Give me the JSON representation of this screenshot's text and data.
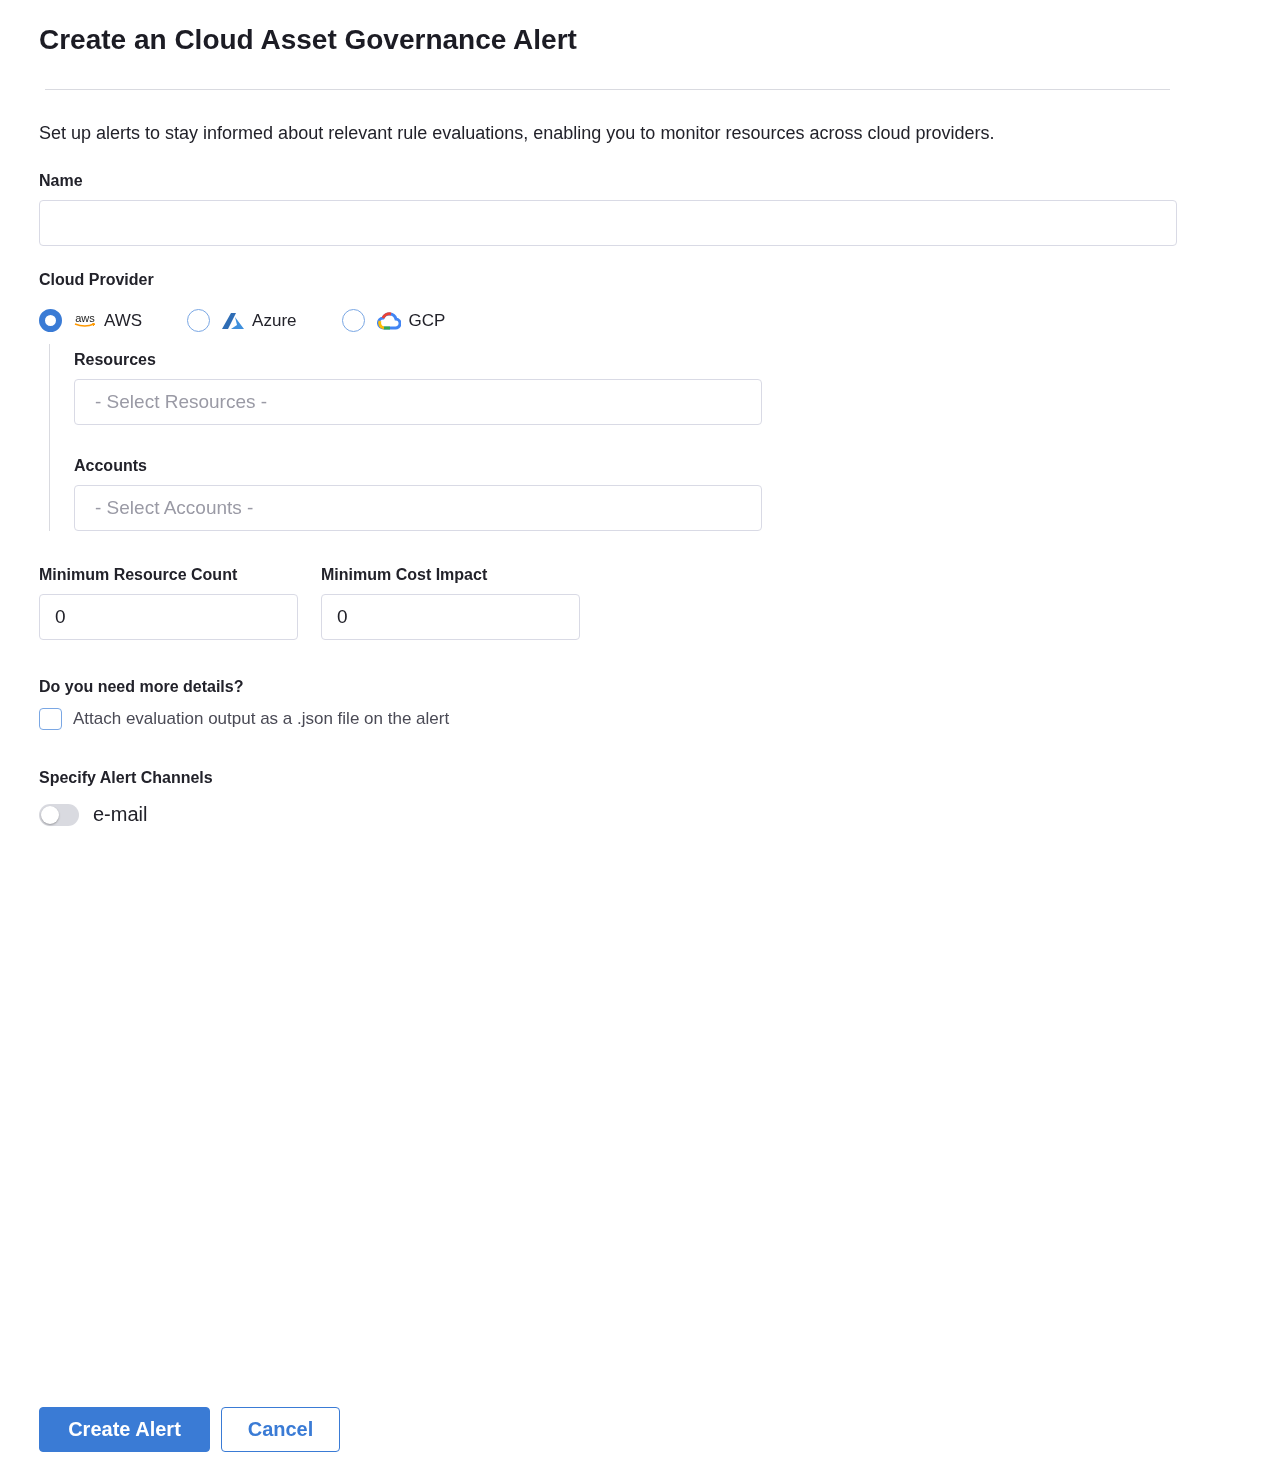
{
  "title": "Create an Cloud Asset Governance Alert",
  "description": "Set up alerts to stay informed about relevant rule evaluations, enabling you to monitor resources across cloud providers.",
  "name_field": {
    "label": "Name"
  },
  "cloud_provider": {
    "label": "Cloud Provider",
    "options": [
      {
        "kind": "aws",
        "logo_text": "aws",
        "label": "AWS",
        "selected": true
      },
      {
        "kind": "azure",
        "label": "Azure",
        "selected": false
      },
      {
        "kind": "gcp",
        "label": "GCP",
        "selected": false
      }
    ]
  },
  "resources": {
    "label": "Resources",
    "placeholder": "- Select Resources -"
  },
  "accounts": {
    "label": "Accounts",
    "placeholder": "- Select Accounts -"
  },
  "min_resource_count": {
    "label": "Minimum Resource Count",
    "value": "0"
  },
  "min_cost_impact": {
    "label": "Minimum Cost Impact",
    "value": "0"
  },
  "details": {
    "label": "Do you need more details?",
    "checkbox": {
      "label": "Attach evaluation output as a .json file on the alert",
      "checked": false
    }
  },
  "channels": {
    "label": "Specify Alert Channels",
    "items": [
      {
        "label": "e-mail",
        "on": false
      }
    ]
  },
  "buttons": [
    {
      "kind": "primary",
      "label": "Create Alert"
    },
    {
      "kind": "secondary",
      "label": "Cancel"
    }
  ]
}
